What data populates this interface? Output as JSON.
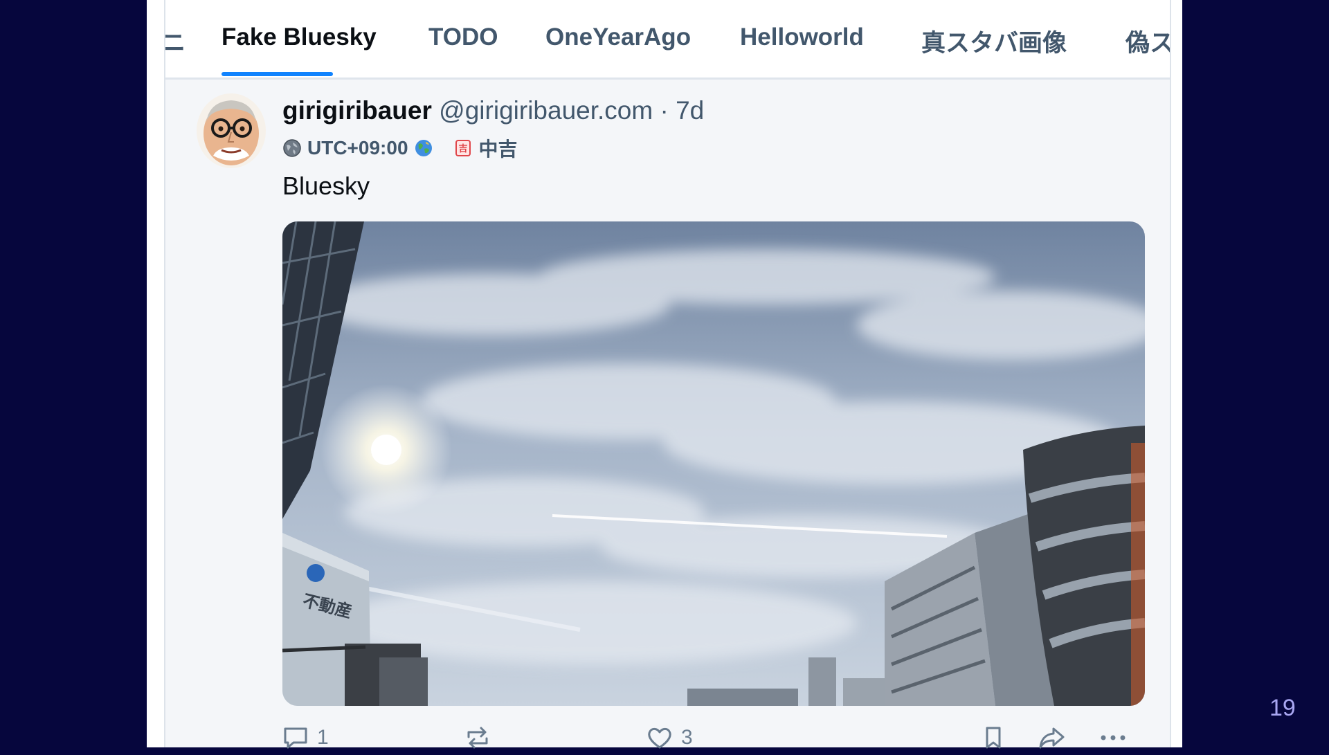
{
  "tabs": [
    {
      "label": "ニ"
    },
    {
      "label": "Fake Bluesky"
    },
    {
      "label": "TODO"
    },
    {
      "label": "OneYearAgo"
    },
    {
      "label": "Helloworld"
    },
    {
      "label": "真スタバ画像"
    },
    {
      "label": "偽ス"
    }
  ],
  "active_tab": "Fake Bluesky",
  "post": {
    "display_name": "girigiribauer",
    "handle": "@girigiribauer.com",
    "separator": "·",
    "age": "7d",
    "timezone": "UTC+09:00",
    "location": "中吉",
    "text": "Bluesky",
    "image_signage": "不動産",
    "reply_count": "1",
    "repost_count": "",
    "like_count": "3"
  },
  "icons": {
    "tz_globe": "globe-icon",
    "tz_earth": "earth-icon",
    "omikuji": "omikuji-icon",
    "reply": "reply-icon",
    "repost": "repost-icon",
    "like": "heart-icon",
    "bookmark": "bookmark-icon",
    "share": "share-icon",
    "more": "more-icon"
  },
  "colors": {
    "background": "#06063d",
    "accent": "#1083fe",
    "text_primary": "#0b0f14",
    "text_secondary": "#42576c"
  },
  "slide_number": "19"
}
